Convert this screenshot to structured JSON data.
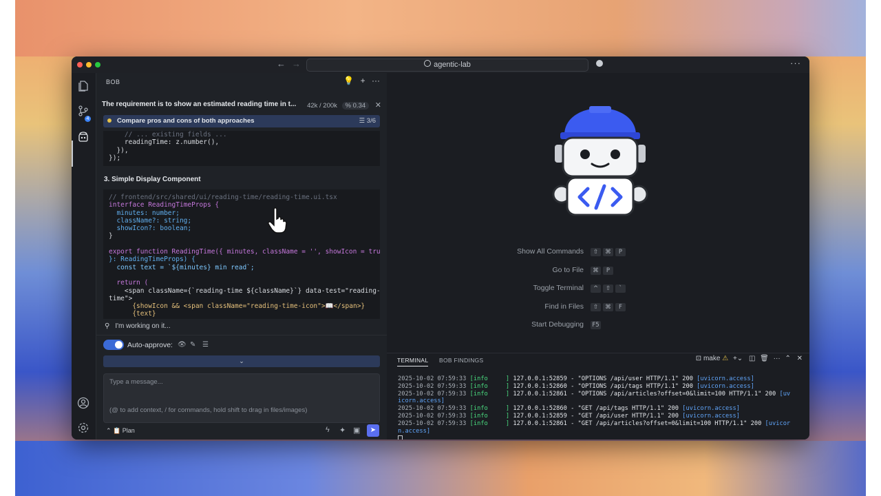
{
  "window": {
    "search_text": "agentic-lab"
  },
  "activity": {
    "scm_badge": "4"
  },
  "panel": {
    "header": "BOB",
    "task": {
      "title": "The requirement is to show an estimated reading time in t...",
      "tokens": "42k / 200k",
      "cost": "0.34"
    },
    "step": {
      "label": "Compare pros and cons of both approaches",
      "count": "3/6"
    },
    "code1": [
      "    // ... existing fields ...",
      "    readingTime: z.number(),",
      "  }),",
      "});"
    ],
    "section_heading": "3. Simple Display Component",
    "code2_lines": [
      "// frontend/src/shared/ui/reading-time/reading-time.ui.tsx",
      "interface ReadingTimeProps {",
      "  minutes: number;",
      "  className?: string;",
      "  showIcon?: boolean;",
      "}",
      "",
      "export function ReadingTime({ minutes, className = '', showIcon = true",
      "}: ReadingTimeProps) {",
      "  const text = `${minutes} min read`;",
      "",
      "  return (",
      "    <span className={`reading-time ${className}`} data-test=\"reading-",
      "time\">",
      "      {showIcon && <span className=\"reading-time-icon\">📖</span>}",
      "      {text}"
    ],
    "working": "I'm working on it...",
    "auto_approve": "Auto-approve:",
    "input_placeholder": "Type a message...",
    "input_hint": "(@ to add context, / for commands, hold shift to drag in files/images)",
    "mode": "Plan"
  },
  "editor": {
    "shortcuts": [
      {
        "name": "Show All Commands",
        "keys": [
          "⇧",
          "⌘",
          "P"
        ]
      },
      {
        "name": "Go to File",
        "keys": [
          "⌘",
          "P"
        ]
      },
      {
        "name": "Toggle Terminal",
        "keys": [
          "^",
          "⇧",
          "`"
        ]
      },
      {
        "name": "Find in Files",
        "keys": [
          "⇧",
          "⌘",
          "F"
        ]
      },
      {
        "name": "Start Debugging",
        "keys": [
          "F5"
        ]
      }
    ]
  },
  "terminal": {
    "tabs": [
      "TERMINAL",
      "BOB FINDINGS"
    ],
    "task_label": "make",
    "lines": [
      {
        "time": "2025-10-02 07:59:33",
        "level": "[info     ]",
        "msg": "127.0.0.1:52859 - \"OPTIONS /api/user HTTP/1.1\" 200",
        "src": "[uvicorn.access]"
      },
      {
        "time": "2025-10-02 07:59:33",
        "level": "[info     ]",
        "msg": "127.0.0.1:52860 - \"OPTIONS /api/tags HTTP/1.1\" 200",
        "src": "[uvicorn.access]"
      },
      {
        "time": "2025-10-02 07:59:33",
        "level": "[info     ]",
        "msg": "127.0.0.1:52861 - \"OPTIONS /api/articles?offset=0&limit=100 HTTP/1.1\" 200",
        "src": "[uv"
      },
      {
        "time": "",
        "level": "",
        "msg": "",
        "src": "icorn.access]"
      },
      {
        "time": "2025-10-02 07:59:33",
        "level": "[info     ]",
        "msg": "127.0.0.1:52860 - \"GET /api/tags HTTP/1.1\" 200",
        "src": "[uvicorn.access]"
      },
      {
        "time": "2025-10-02 07:59:33",
        "level": "[info     ]",
        "msg": "127.0.0.1:52859 - \"GET /api/user HTTP/1.1\" 200",
        "src": "[uvicorn.access]"
      },
      {
        "time": "2025-10-02 07:59:33",
        "level": "[info     ]",
        "msg": "127.0.0.1:52861 - \"GET /api/articles?offset=0&limit=100 HTTP/1.1\" 200",
        "src": "[uvicor"
      },
      {
        "time": "",
        "level": "",
        "msg": "",
        "src": "n.access]"
      }
    ]
  }
}
